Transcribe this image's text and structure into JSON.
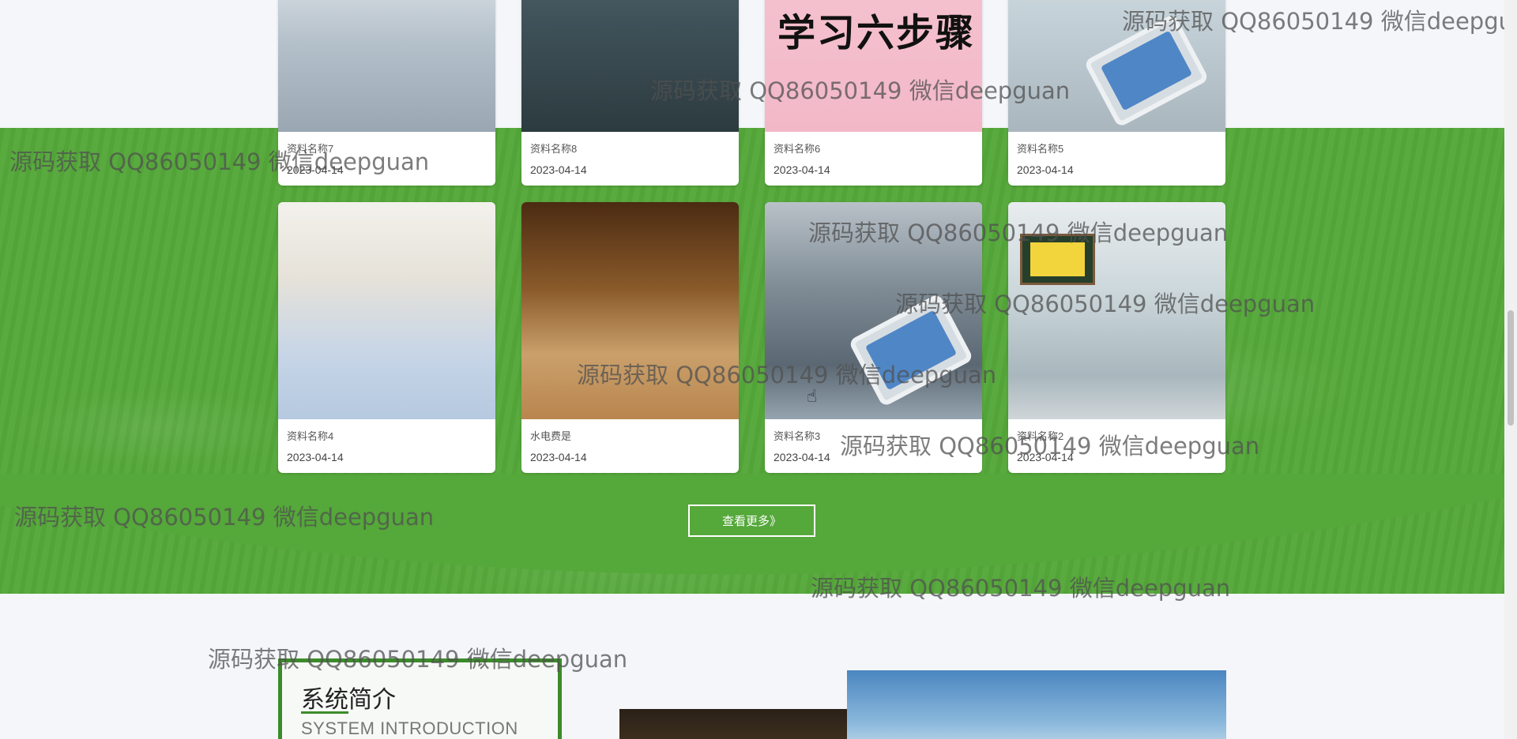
{
  "cards_row1": [
    {
      "name": "资料名称7",
      "date": "2023-04-14"
    },
    {
      "name": "资料名称8",
      "date": "2023-04-14"
    },
    {
      "name": "资料名称6",
      "date": "2023-04-14",
      "image_text": "学习六步骤"
    },
    {
      "name": "资料名称5",
      "date": "2023-04-14"
    }
  ],
  "cards_row2": [
    {
      "name": "资料名称4",
      "date": "2023-04-14"
    },
    {
      "name": "水电费是",
      "date": "2023-04-14"
    },
    {
      "name": "资料名称3",
      "date": "2023-04-14"
    },
    {
      "name": "资料名称2",
      "date": "2023-04-14"
    }
  ],
  "view_more": {
    "label": "查看更多》"
  },
  "intro": {
    "title": "系统简介",
    "subtitle": "SYSTEM INTRODUCTION"
  },
  "watermark": {
    "text": "源码获取 QQ86050149 微信deepguan"
  },
  "colors": {
    "green": "#55a83a",
    "dark_green": "#3c8b2b",
    "background": "#f4f6f9"
  }
}
